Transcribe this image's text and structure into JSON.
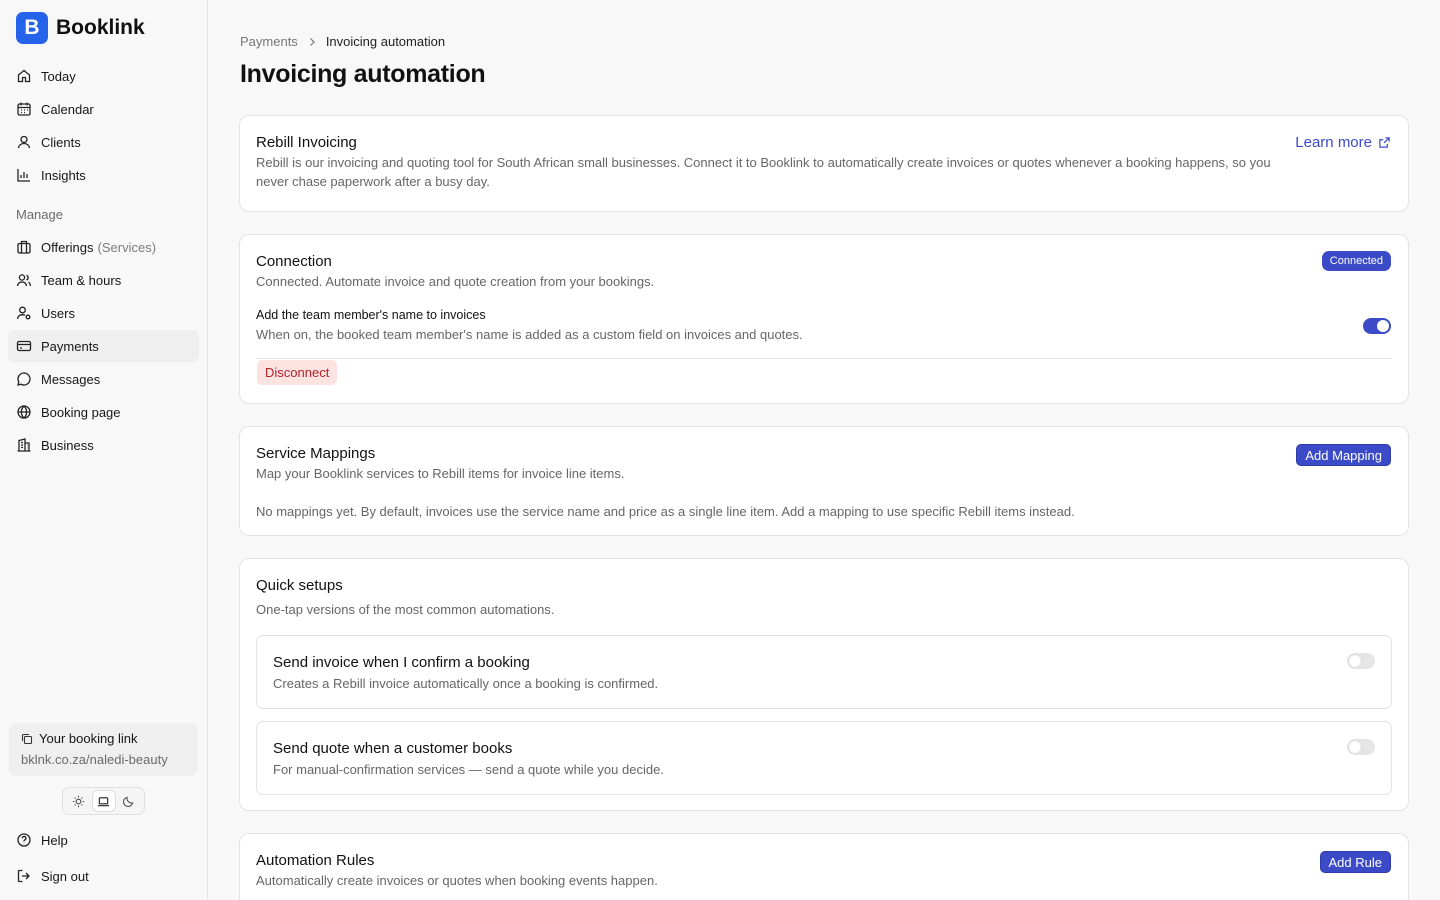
{
  "brand": {
    "logo_letter": "B",
    "name": "Booklink",
    "accent": "#2563eb"
  },
  "sidebar": {
    "items": [
      {
        "label": "Today",
        "icon": "home-icon"
      },
      {
        "label": "Calendar",
        "icon": "calendar-icon"
      },
      {
        "label": "Clients",
        "icon": "user-icon"
      },
      {
        "label": "Insights",
        "icon": "chart-icon"
      }
    ],
    "manage_label": "Manage",
    "manage_items": [
      {
        "label": "Offerings",
        "suffix": "(Services)",
        "icon": "briefcase-icon"
      },
      {
        "label": "Team & hours",
        "icon": "team-icon"
      },
      {
        "label": "Users",
        "icon": "user-settings-icon"
      },
      {
        "label": "Payments",
        "icon": "credit-card-icon",
        "active": true
      },
      {
        "label": "Messages",
        "icon": "message-icon"
      },
      {
        "label": "Booking page",
        "icon": "globe-icon"
      },
      {
        "label": "Business",
        "icon": "building-icon"
      }
    ],
    "booking_link": {
      "title": "Your booking link",
      "url": "bklnk.co.za/naledi-beauty"
    },
    "theme": {
      "selected": "system",
      "options": [
        "light",
        "system",
        "dark"
      ]
    },
    "help_label": "Help",
    "signout_label": "Sign out"
  },
  "breadcrumb": {
    "parent": "Payments",
    "current": "Invoicing automation"
  },
  "page": {
    "title": "Invoicing automation"
  },
  "rebill": {
    "title": "Rebill Invoicing",
    "description": "Rebill is our invoicing and quoting tool for South African small businesses. Connect it to Booklink to automatically create invoices or quotes whenever a booking happens, so you never chase paperwork after a busy day.",
    "learn_more": "Learn more"
  },
  "connection": {
    "title": "Connection",
    "description": "Connected. Automate invoice and quote creation from your bookings.",
    "status_badge": "Connected",
    "team_member_setting": {
      "title": "Add the team member's name to invoices",
      "description": "When on, the booked team member's name is added as a custom field on invoices and quotes.",
      "enabled": true
    },
    "disconnect_label": "Disconnect"
  },
  "service_mappings": {
    "title": "Service Mappings",
    "description": "Map your Booklink services to Rebill items for invoice line items.",
    "add_label": "Add Mapping",
    "empty_text": "No mappings yet. By default, invoices use the service name and price as a single line item. Add a mapping to use specific Rebill items instead."
  },
  "quick_setups": {
    "title": "Quick setups",
    "description": "One-tap versions of the most common automations.",
    "items": [
      {
        "title": "Send invoice when I confirm a booking",
        "description": "Creates a Rebill invoice automatically once a booking is confirmed.",
        "enabled": false
      },
      {
        "title": "Send quote when a customer books",
        "description": "For manual-confirmation services — send a quote while you decide.",
        "enabled": false
      }
    ]
  },
  "automation_rules": {
    "title": "Automation Rules",
    "description": "Automatically create invoices or quotes when booking events happen.",
    "add_label": "Add Rule"
  },
  "colors": {
    "primary": "#3b4bc7",
    "danger_bg": "#fde2e2",
    "danger_text": "#b4232a"
  }
}
